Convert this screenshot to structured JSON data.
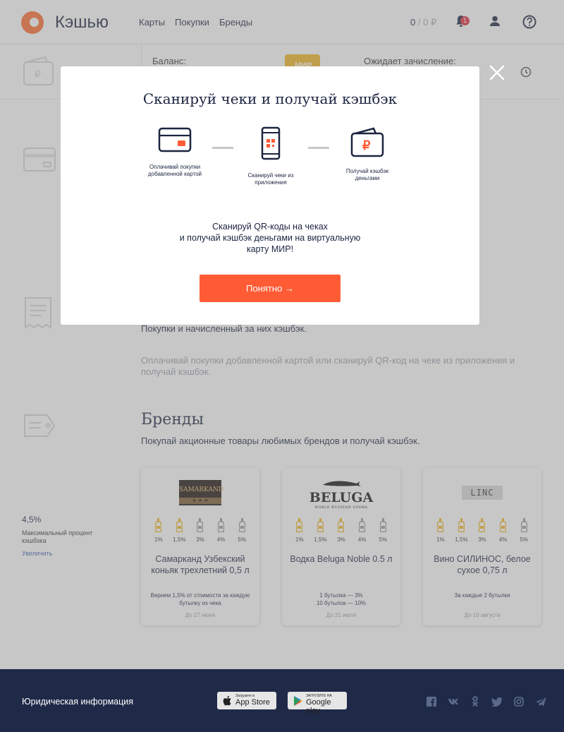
{
  "header": {
    "logo_text": "Кэшью",
    "nav": [
      "Карты",
      "Покупки",
      "Бренды"
    ],
    "balance_value": "0",
    "balance_pending": "0 ₽",
    "notifications_count": "1"
  },
  "balance_strip": {
    "balance_label": "Баланс:",
    "card_brand": "МИР",
    "pending_label": "Ожидает зачисление:"
  },
  "purchases": {
    "subtitle": "Покупки и начисленный за них кэшбэк.",
    "hint": "Оплачивай покупки добавленной картой или сканируй QR-код на чеке из приложения и получай кэшбэк."
  },
  "brands": {
    "title": "Бренды",
    "subtitle": "Покупай акционные товары любимых брендов и получай кэшбэк.",
    "side": {
      "value": "4,5%",
      "label": "Максимальный процент кэшбэка",
      "link": "Увеличить"
    },
    "percents": [
      "1%",
      "1,5%",
      "3%",
      "4%",
      "5%"
    ],
    "cards": [
      {
        "logo": "SAMARKAND",
        "name": "Самарканд Узбекский коньяк трехлетний 0,5 л",
        "desc": "Вернем 1,5% от стоимости за каждую бутылку из чека",
        "date": "До 27 июня",
        "active": 2
      },
      {
        "logo": "BELUGA",
        "logo_sub": "NOBLE RUSSIAN VODKA",
        "name": "Водка Beluga Noble 0.5 л",
        "desc_line1": "1 бутылка — 3%",
        "desc_line2": "10 бутылок — 10%",
        "date": "До 21 июля",
        "active": 3
      },
      {
        "logo": "LINC",
        "name": "Вино СИЛИНОС, белое сухое 0,75 л",
        "desc": "За каждые 2 бутылки",
        "date": "До 10 августа",
        "active": 4
      }
    ]
  },
  "footer": {
    "legal": "Юридическая информация",
    "appstore_small": "Загрузите в",
    "appstore_big": "App Store",
    "googleplay_small": "ЗАГРУЗИТЕ НА",
    "googleplay_big": "Google play"
  },
  "modal": {
    "title": "Сканируй чеки и получай кэшбэк",
    "steps": [
      {
        "icon": "credit-card-icon",
        "caption": "Оплачивай покупки добавленной картой"
      },
      {
        "icon": "phone-qr-icon",
        "caption": "Сканируй чеки из приложения"
      },
      {
        "icon": "wallet-ruble-icon",
        "caption": "Получай кэшбэк деньгами"
      }
    ],
    "body_line1": "Сканируй QR-коды на чеках",
    "body_line2": "и получай кэшбэк деньгами на виртуальную",
    "body_line3": "карту МИР!",
    "button": "Понятно →"
  },
  "colors": {
    "accent": "#ff5c36",
    "navy": "#1b2440",
    "footer": "#1f2a48",
    "bottle_active": "#f2b61f",
    "bottle_inactive": "#9a9a9a"
  }
}
